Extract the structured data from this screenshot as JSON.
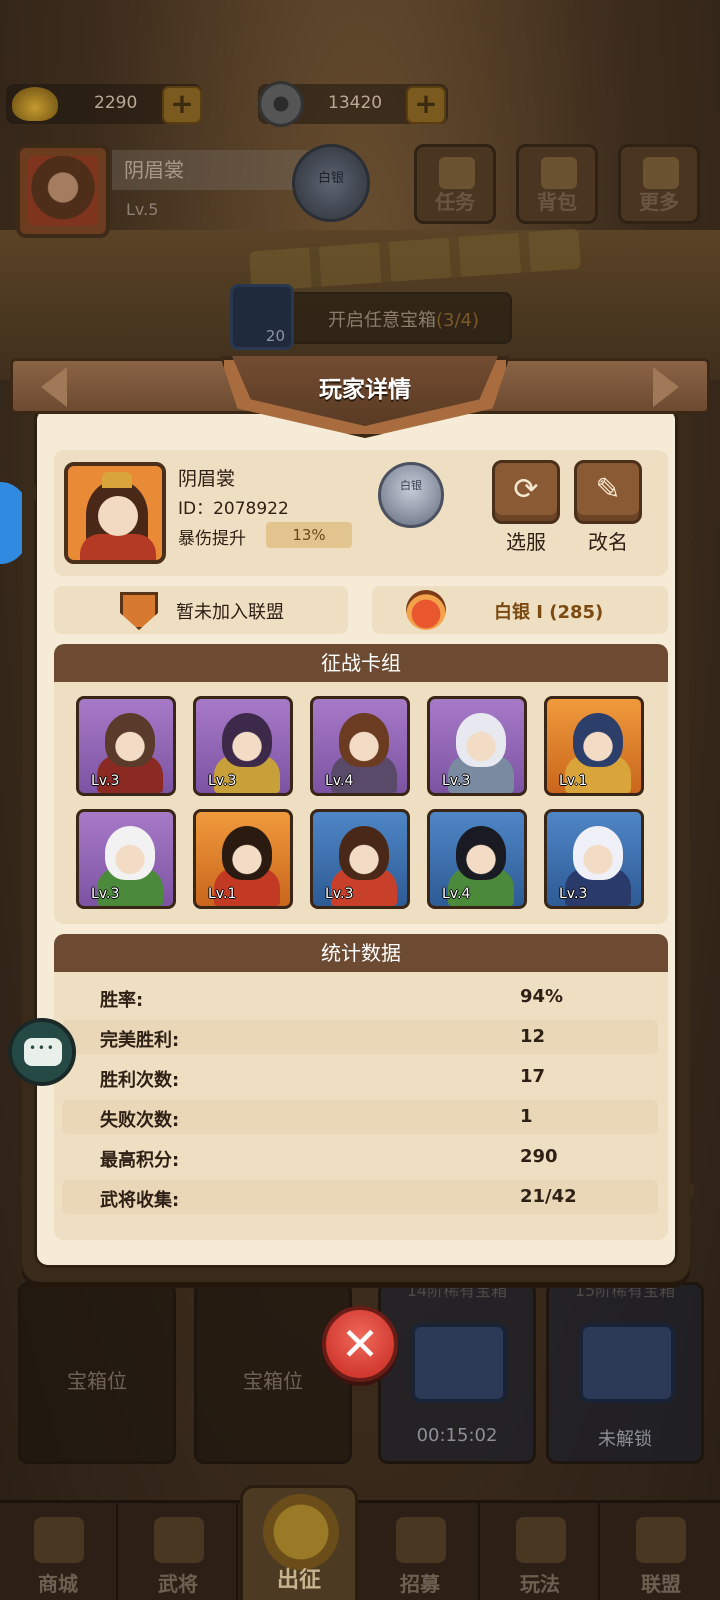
{
  "resources": {
    "gold": "2290",
    "coins": "13420"
  },
  "player_bar": {
    "name": "阴眉裳",
    "level": "Lv.5",
    "rank": "白银"
  },
  "top_buttons": [
    {
      "label": "任务",
      "icon": "scroll-icon"
    },
    {
      "label": "背包",
      "icon": "bag-icon"
    },
    {
      "label": "更多",
      "icon": "menu-icon"
    }
  ],
  "chest_banner": {
    "count": "20",
    "text": "开启任意宝箱",
    "progress": "(3/4)"
  },
  "dialog": {
    "title": "玩家详情",
    "profile": {
      "name": "阴眉裳",
      "id": "ID：2078922",
      "crit_label": "暴伤提升",
      "crit_value": "13%",
      "rank_badge": "白银",
      "switch_server": "选服",
      "rename": "改名"
    },
    "alliance": "暂未加入联盟",
    "rank_text": "白银 I (285)",
    "deck": {
      "title": "征战卡组",
      "cards": [
        {
          "level": "Lv.3",
          "rarity": "purple",
          "hair": "#5a3a2a",
          "body": "#8b2a22"
        },
        {
          "level": "Lv.3",
          "rarity": "purple",
          "hair": "#3d2a4a",
          "body": "#c8a03a"
        },
        {
          "level": "Lv.4",
          "rarity": "purple",
          "hair": "#6b3b22",
          "body": "#5a4a6a"
        },
        {
          "level": "Lv.3",
          "rarity": "purple",
          "hair": "#e8e8f0",
          "body": "#7a8aa0"
        },
        {
          "level": "Lv.1",
          "rarity": "orange",
          "hair": "#2c3f6a",
          "body": "#d9a53a"
        },
        {
          "level": "Lv.3",
          "rarity": "purple",
          "hair": "#f2f2f2",
          "body": "#4a8a3a"
        },
        {
          "level": "Lv.1",
          "rarity": "orange",
          "hair": "#2b1a10",
          "body": "#c23a24"
        },
        {
          "level": "Lv.3",
          "rarity": "blue",
          "hair": "#4a2818",
          "body": "#c8402a"
        },
        {
          "level": "Lv.4",
          "rarity": "blue",
          "hair": "#1a1a22",
          "body": "#4a8a3a"
        },
        {
          "level": "Lv.3",
          "rarity": "blue",
          "hair": "#f0f0f8",
          "body": "#2a3a6a"
        }
      ]
    },
    "stats": {
      "title": "统计数据",
      "rows": [
        {
          "label": "胜率:",
          "value": "94%"
        },
        {
          "label": "完美胜利:",
          "value": "12"
        },
        {
          "label": "胜利次数:",
          "value": "17"
        },
        {
          "label": "失败次数:",
          "value": "1"
        },
        {
          "label": "最高积分:",
          "value": "290"
        },
        {
          "label": "武将收集:",
          "value": "21/42"
        }
      ]
    }
  },
  "slots": [
    {
      "label": "宝箱位",
      "type": "empty"
    },
    {
      "label": "宝箱位",
      "type": "empty"
    },
    {
      "label": "00:15:02",
      "type": "chest",
      "caption": "14阶稀有宝箱"
    },
    {
      "label": "未解锁",
      "type": "chest",
      "caption": "15阶稀有宝箱"
    }
  ],
  "nav": [
    {
      "label": "商城",
      "active": false
    },
    {
      "label": "武将",
      "active": false
    },
    {
      "label": "出征",
      "active": true
    },
    {
      "label": "招募",
      "active": false
    },
    {
      "label": "玩法",
      "active": false
    },
    {
      "label": "联盟",
      "active": false
    }
  ]
}
